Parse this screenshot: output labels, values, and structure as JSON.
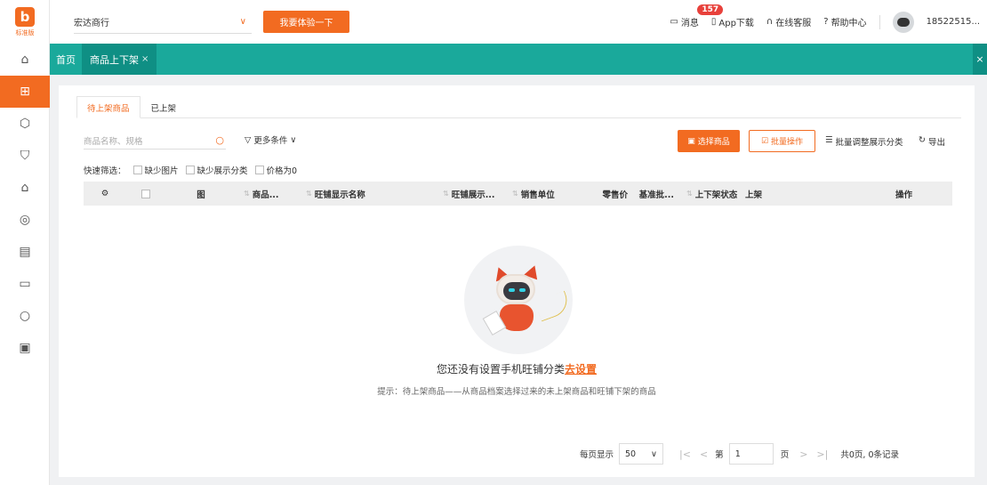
{
  "logo": {
    "mark": "b",
    "text": "标准版"
  },
  "topbar": {
    "shop_name": "宏达商行",
    "try_button": "我要体验一下",
    "messages_label": "消息",
    "messages_count": "157",
    "app_download": "App下载",
    "online_service": "在线客服",
    "help_center": "帮助中心",
    "user_phone": "18522515..."
  },
  "tabs": {
    "home": "首页",
    "current": "商品上下架",
    "close": "×",
    "close_all": "×"
  },
  "subtabs": {
    "pending": "待上架商品",
    "listed": "已上架"
  },
  "search": {
    "placeholder": "商品名称、规格"
  },
  "toolbar": {
    "more_conditions": "更多条件",
    "select_goods": "选择商品",
    "batch_ops": "批量操作",
    "batch_adjust": "批量调整展示分类",
    "export": "导出"
  },
  "quick_filter": {
    "label": "快速筛选：",
    "missing_image": "缺少图片",
    "missing_category": "缺少展示分类",
    "price_zero": "价格为0"
  },
  "table": {
    "columns": [
      "图",
      "商品...",
      "旺铺显示名称",
      "旺铺展示...",
      "销售单位",
      "零售价",
      "基准批...",
      "上下架状态",
      "上架",
      "操作"
    ]
  },
  "empty": {
    "title": "您还没有设置手机旺铺分类",
    "link": "去设置",
    "hint": "提示：待上架商品——从商品档案选择过来的未上架商品和旺铺下架的商品"
  },
  "pager": {
    "per_page_label": "每页显示",
    "per_page": "50",
    "page_prefix": "第",
    "page": "1",
    "page_suffix": "页",
    "summary": "共0页, 0条记录"
  },
  "colors": {
    "accent": "#f26b21",
    "teal": "#1aa99b"
  }
}
